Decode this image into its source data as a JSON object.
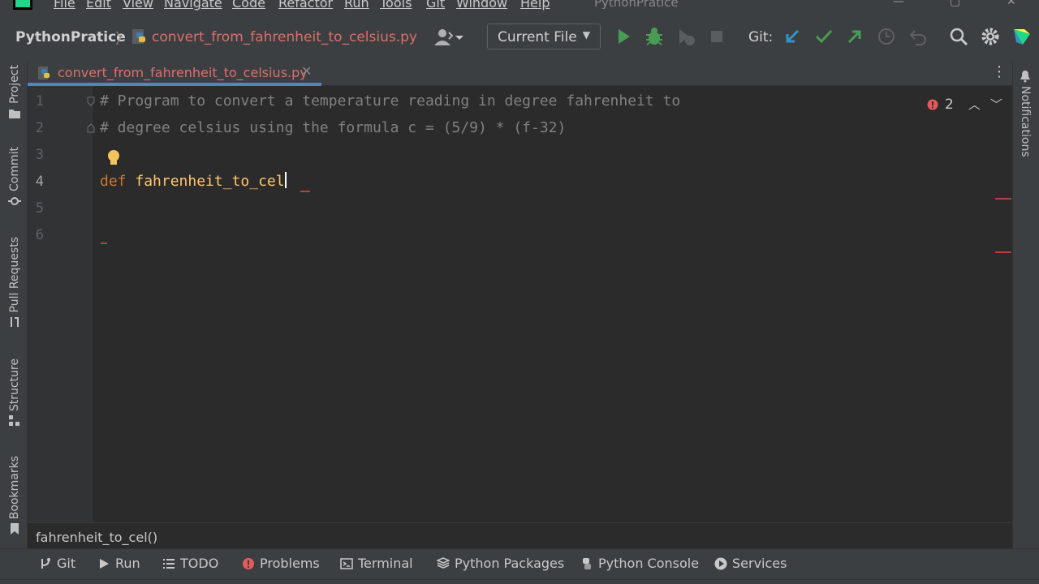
{
  "window": {
    "title": "PythonPratice",
    "menu": [
      "File",
      "Edit",
      "View",
      "Navigate",
      "Code",
      "Refactor",
      "Run",
      "Tools",
      "Git",
      "Window",
      "Help"
    ]
  },
  "navbar": {
    "project": "PythonPratice",
    "file": "convert_from_fahrenheit_to_celsius.py"
  },
  "toolbar": {
    "run_config": "Current File",
    "git_label": "Git:"
  },
  "left_tools": [
    "Project",
    "Commit",
    "Pull Requests",
    "Structure",
    "Bookmarks"
  ],
  "right_tools": [
    "Notifications"
  ],
  "editor_tab": {
    "label": "convert_from_fahrenheit_to_celsius.py"
  },
  "editor": {
    "line_numbers": [
      "1",
      "2",
      "3",
      "4",
      "5",
      "6"
    ],
    "lines": {
      "l1": "# Program to convert a temperature reading in degree fahrenheit to",
      "l2": "# degree celsius using the formula c = (5/9) * (f-32)",
      "l4_kw": "def",
      "l4_name": "fahrenheit_to_cel"
    },
    "error_count": "2"
  },
  "breadcrumb": "fahrenheit_to_cel()",
  "bottom_tools": [
    "Git",
    "Run",
    "TODO",
    "Problems",
    "Terminal",
    "Python Packages",
    "Python Console",
    "Services"
  ],
  "colors": {
    "accent": "#4a88c7",
    "error": "#bc3f3c",
    "run_green": "#499c54",
    "keyword": "#cc7832",
    "function": "#ffc66d",
    "comment": "#808080"
  }
}
